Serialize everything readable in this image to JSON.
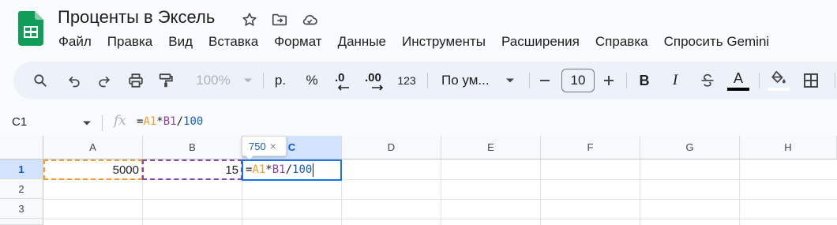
{
  "doc": {
    "title": "Проценты в Эксель"
  },
  "menu": [
    "Файл",
    "Правка",
    "Вид",
    "Вставка",
    "Формат",
    "Данные",
    "Инструменты",
    "Расширения",
    "Справка",
    "Спросить Gemini"
  ],
  "toolbar": {
    "zoom": "100%",
    "currency": "р.",
    "percent": "%",
    "dec_less": ".0",
    "dec_more": ".00",
    "number_format": "123",
    "font": "По ум...",
    "font_size": "10",
    "bold": "B",
    "italic": "I",
    "text_color_letter": "A"
  },
  "formula_bar": {
    "name_box": "C1",
    "fx": "fx",
    "formula": {
      "eq": "=",
      "ref1": "A1",
      "op": "*",
      "ref2": "B1",
      "div": "/",
      "num": "100"
    }
  },
  "grid": {
    "columns": [
      "A",
      "B",
      "C",
      "D",
      "E",
      "F",
      "G",
      "H"
    ],
    "rows": [
      "1",
      "2",
      "3"
    ],
    "cells": {
      "A1": "5000",
      "B1": "15"
    }
  },
  "tooltip": {
    "value": "750",
    "close": "×"
  },
  "colors": {
    "ref_a1": "#f39c32",
    "ref_b1": "#8e44ad",
    "number": "#1a5fb4",
    "selection": "#1a73e8",
    "logo": "#0f9d58"
  }
}
